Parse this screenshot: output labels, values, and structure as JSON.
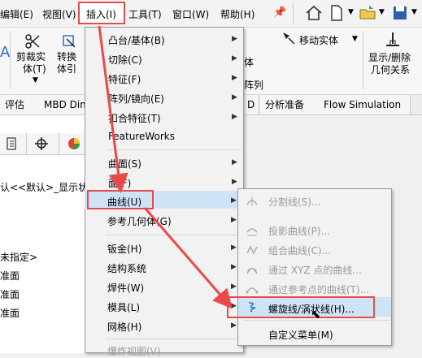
{
  "menubar": {
    "items": [
      {
        "label": "编辑(E)"
      },
      {
        "label": "视图(V)"
      },
      {
        "label": "插入(I)"
      },
      {
        "label": "工具(T)"
      },
      {
        "label": "窗口(W)"
      },
      {
        "label": "帮助(H)"
      }
    ]
  },
  "ribbon": {
    "trim_label_1": "剪裁实",
    "trim_label_2": "体(T)",
    "convert_label_1": "转换",
    "convert_label_2": "体引",
    "move_entity": "移动实体",
    "solid_fragment": "体",
    "array_fragment": "阵列",
    "show_hide_1": "显示/删除",
    "show_hide_2": "几何关系"
  },
  "tabs": [
    {
      "label": "评估"
    },
    {
      "label": "MBD Dim"
    },
    {
      "label": "D"
    },
    {
      "label": "分析准备"
    },
    {
      "label": "Flow Simulation"
    }
  ],
  "panel": {
    "config_text": "认<<默认>_显示状",
    "unspecified": "未指定>",
    "plane1": "准面",
    "plane2": "准面",
    "plane3": "准面"
  },
  "insert_menu": {
    "items": [
      {
        "label": "凸台/基体(B)"
      },
      {
        "label": "切除(C)"
      },
      {
        "label": "特征(F)"
      },
      {
        "label": "阵列/镜向(E)"
      },
      {
        "label": "扣合特征(T)"
      },
      {
        "label": "FeatureWorks"
      },
      {
        "label": "曲面(S)"
      },
      {
        "label": "面(F)"
      },
      {
        "label": "曲线(U)"
      },
      {
        "label": "参考几何体(G)"
      },
      {
        "label": "钣金(H)"
      },
      {
        "label": "结构系统"
      },
      {
        "label": "焊件(W)"
      },
      {
        "label": "模具(L)"
      },
      {
        "label": "网格(H)"
      },
      {
        "label": "爆炸视图(V)"
      }
    ]
  },
  "curve_submenu": {
    "items": [
      {
        "label": "分割线(S)..."
      },
      {
        "label": "投影曲线(P)..."
      },
      {
        "label": "组合曲线(C)..."
      },
      {
        "label": "通过 XYZ 点的曲线..."
      },
      {
        "label": "通过参考点的曲线(T)..."
      },
      {
        "label": "螺旋线/涡状线(H)..."
      },
      {
        "label": "自定义菜单(M)"
      }
    ]
  },
  "colors": {
    "highlight_red": "#e84a4a",
    "hover_blue": "#cfe3f7"
  }
}
